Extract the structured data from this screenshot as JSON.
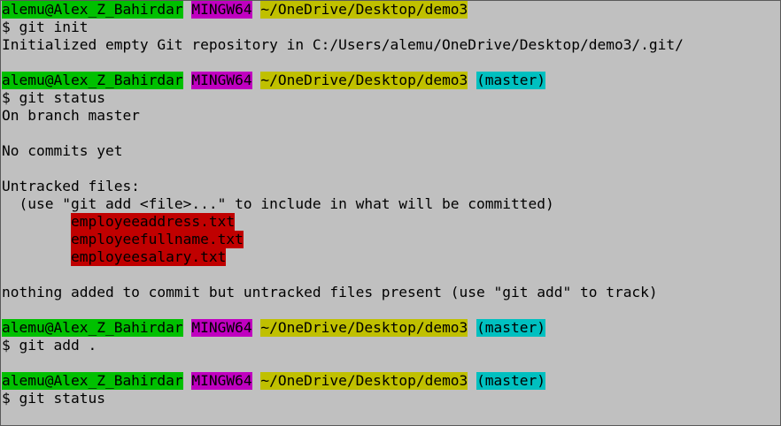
{
  "colors": {
    "background": "#c0c0c0",
    "user_bg": "#00c000",
    "host_bg": "#c000c0",
    "path_bg": "#c0c000",
    "branch_bg": "#00c0c0",
    "untracked_file_bg": "#c00000"
  },
  "prompt": {
    "user": "alemu@Alex_Z_Bahirdar",
    "host": "MINGW64",
    "path": "~/OneDrive/Desktop/demo3",
    "branch": "(master)"
  },
  "session": {
    "cmd1": "$ git init",
    "init_output": "Initialized empty Git repository in C:/Users/alemu/OneDrive/Desktop/demo3/.git/",
    "cmd2": "$ git status",
    "on_branch": "On branch master",
    "no_commits": "No commits yet",
    "untracked_header": "Untracked files:",
    "untracked_hint": "  (use \"git add <file>...\" to include in what will be committed)",
    "untracked_files": [
      "employeeaddress.txt",
      "employeefullname.txt",
      "employeesalary.txt"
    ],
    "nothing_added": "nothing added to commit but untracked files present (use \"git add\" to track)",
    "cmd3": "$ git add .",
    "cmd4": "$ git status"
  }
}
